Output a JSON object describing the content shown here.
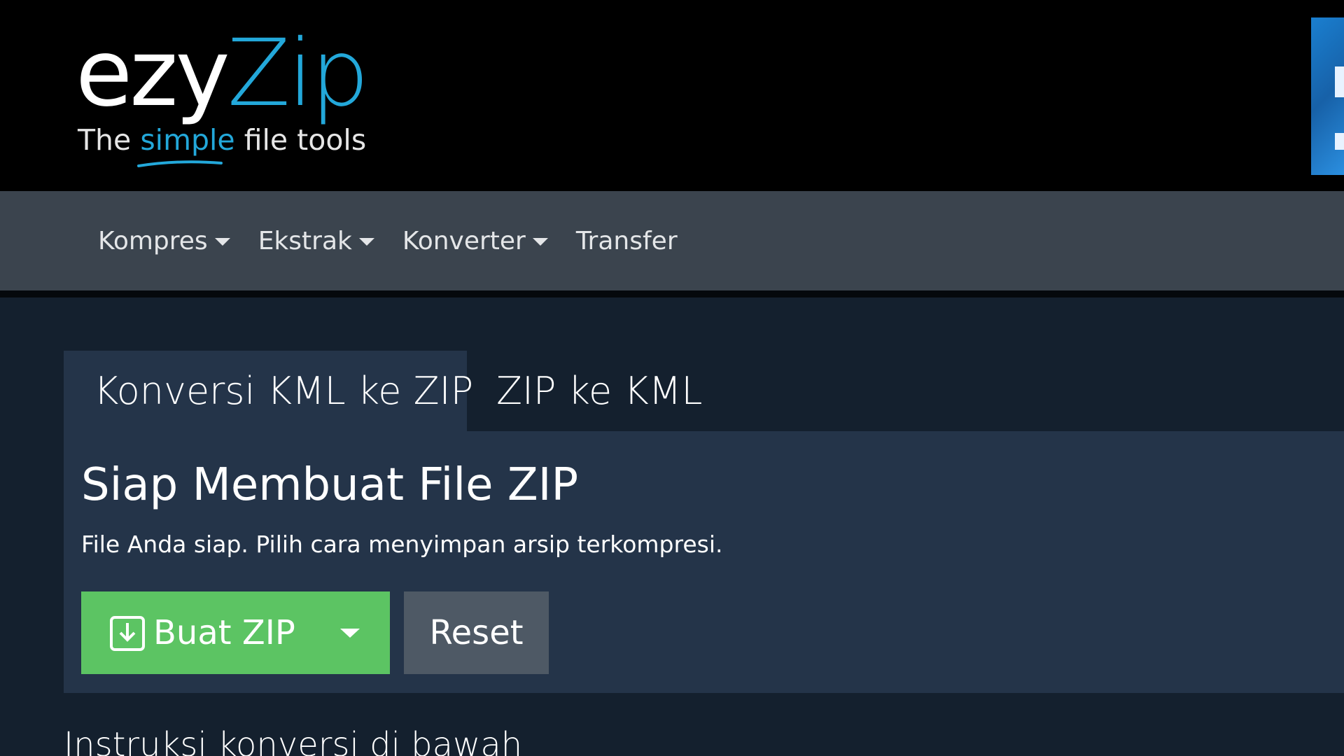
{
  "header": {
    "logo": {
      "word_main": "ezy",
      "word_accent": "Zip",
      "tagline_before": "The",
      "tagline_accent": "simple",
      "tagline_after": "file tools"
    },
    "colors": {
      "brand_blue": "#23a8da",
      "header_bg": "#000000"
    }
  },
  "nav": {
    "items": [
      {
        "label": "Kompres",
        "has_dropdown": true
      },
      {
        "label": "Ekstrak",
        "has_dropdown": true
      },
      {
        "label": "Konverter",
        "has_dropdown": true
      },
      {
        "label": "Transfer",
        "has_dropdown": false
      }
    ]
  },
  "tabs": [
    {
      "label": "Konversi KML ke ZIP",
      "active": true
    },
    {
      "label": "ZIP ke KML",
      "active": false
    }
  ],
  "card": {
    "title": "Siap Membuat File ZIP",
    "description": "File Anda siap. Pilih cara menyimpan arsip terkompresi.",
    "primary_button": {
      "label": "Buat ZIP",
      "icon": "download-icon",
      "color": "#5cc463"
    },
    "reset_button": {
      "label": "Reset",
      "color": "#4e5965"
    }
  },
  "instructions": {
    "heading": "Instruksi konversi di bawah"
  }
}
